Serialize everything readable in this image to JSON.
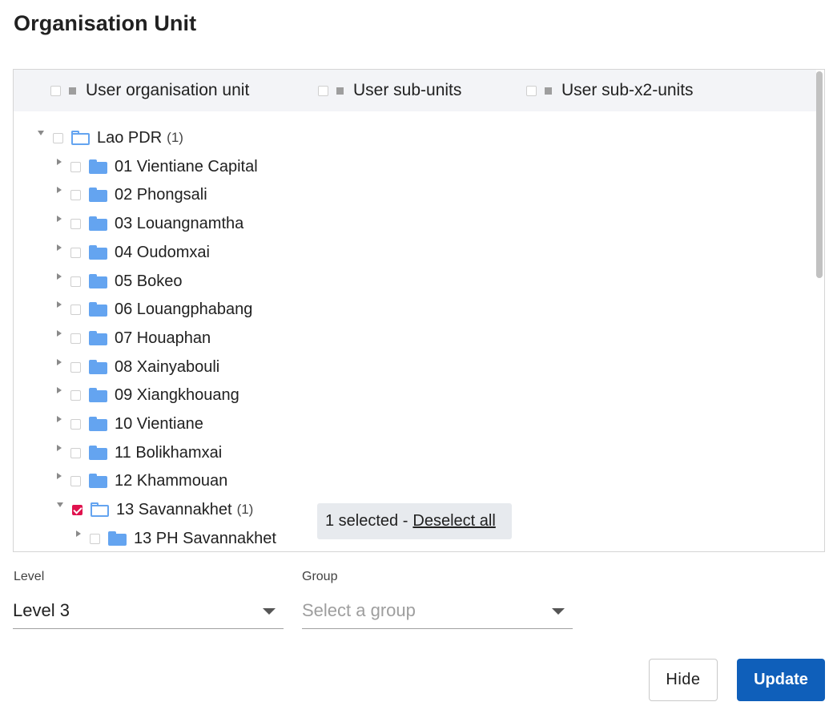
{
  "page": {
    "title": "Organisation Unit"
  },
  "options": [
    {
      "label": "User organisation unit"
    },
    {
      "label": "User sub-units"
    },
    {
      "label": "User sub-x2-units"
    }
  ],
  "tree": {
    "root": {
      "label": "Lao PDR",
      "count": "(1)"
    },
    "children": [
      {
        "label": "01 Vientiane Capital"
      },
      {
        "label": "02 Phongsali"
      },
      {
        "label": "03 Louangnamtha"
      },
      {
        "label": "04 Oudomxai"
      },
      {
        "label": "05 Bokeo"
      },
      {
        "label": "06 Louangphabang"
      },
      {
        "label": "07 Houaphan"
      },
      {
        "label": "08 Xainyabouli"
      },
      {
        "label": "09 Xiangkhouang"
      },
      {
        "label": "10 Vientiane"
      },
      {
        "label": "11 Bolikhamxai"
      },
      {
        "label": "12 Khammouan"
      },
      {
        "label": "13 Savannakhet",
        "count": "(1)"
      }
    ],
    "grandchildren": [
      {
        "label": "13 PH Savannakhet"
      }
    ]
  },
  "selection": {
    "text": "1 selected -",
    "link": "Deselect all"
  },
  "level": {
    "label": "Level",
    "value": "Level 3"
  },
  "group": {
    "label": "Group",
    "placeholder": "Select a group"
  },
  "buttons": {
    "hide": "Hide",
    "update": "Update"
  },
  "colors": {
    "accent": "#e0134e",
    "primary": "#0f5fba",
    "folder": "#64a4f0"
  }
}
